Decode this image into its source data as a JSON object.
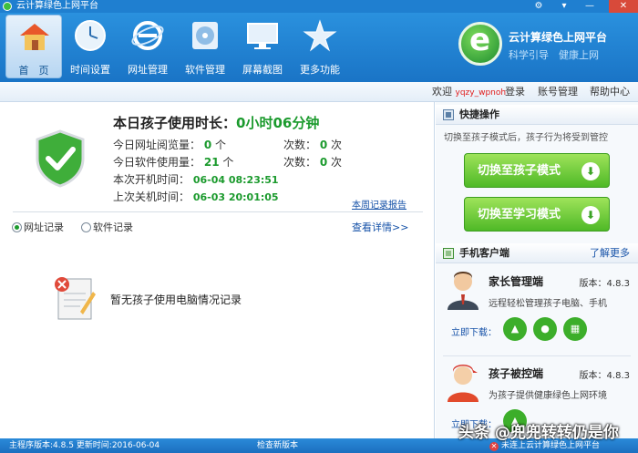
{
  "window": {
    "title": "云计算绿色上网平台",
    "settings_icon": "gear-icon",
    "menu_icon": "dropdown-icon",
    "minimize": "—",
    "close": "✕"
  },
  "toolbar": {
    "items": [
      {
        "label": "首　页",
        "icon": "home-icon"
      },
      {
        "label": "时间设置",
        "icon": "clock-icon"
      },
      {
        "label": "网址管理",
        "icon": "ie-icon"
      },
      {
        "label": "软件管理",
        "icon": "disc-icon"
      },
      {
        "label": "屏幕截图",
        "icon": "monitor-icon"
      },
      {
        "label": "更多功能",
        "icon": "star-icon"
      }
    ]
  },
  "brand": {
    "name": "云计算绿色上网平台",
    "slogan": "科学引导　健康上网"
  },
  "account": {
    "welcome": "欢迎",
    "user": "yqzy_wpnoh",
    "login": "登录",
    "manage": "账号管理",
    "help": "帮助中心"
  },
  "usage": {
    "title_prefix": "本日孩子使用时长：",
    "title_value": "0小时06分钟",
    "url_label": "今日网址阅览量：",
    "url_count": "0",
    "url_unit": "个",
    "url_times_label": "次数：",
    "url_times": "0",
    "times_unit": "次",
    "sw_label": "今日软件使用量：",
    "sw_count": "21",
    "sw_unit": "个",
    "sw_times_label": "次数：",
    "sw_times": "0",
    "boot_label": "本次开机时间：",
    "boot_time": "06-04 08:23:51",
    "shutdown_label": "上次关机时间：",
    "shutdown_time": "06-03 20:01:05",
    "weekly_report": "本周记录报告"
  },
  "records": {
    "tab_url": "网址记录",
    "tab_software": "软件记录",
    "selected": "网址记录",
    "more": "查看详情>>",
    "empty": "暂无孩子使用电脑情况记录"
  },
  "quick": {
    "title": "快捷操作",
    "desc": "切换至孩子模式后，孩子行为将受到管控",
    "btn_child": "切换至孩子模式",
    "btn_study": "切换至学习模式"
  },
  "mobile": {
    "title": "手机客户端",
    "more": "了解更多",
    "parent": {
      "name": "家长管理端",
      "version": "版本：4.8.3",
      "desc": "远程轻松管理孩子电脑、手机",
      "download": "立即下载："
    },
    "child": {
      "name": "孩子被控端",
      "version": "版本：4.8.3",
      "desc": "为孩子提供健康绿色上网环境",
      "download": "立即下载："
    }
  },
  "status": {
    "left": "主程序版本:4.8.5  更新时间:2016-06-04",
    "center": "检查新版本",
    "right": "未连上云计算绿色上网平台",
    "watermark": "头条 @兜兜转转仍是你"
  },
  "colors": {
    "titlebar": "#1f7fd0",
    "accent_green": "#1b9a2d",
    "link_blue": "#1652a8",
    "button_green": "#4fb927"
  }
}
